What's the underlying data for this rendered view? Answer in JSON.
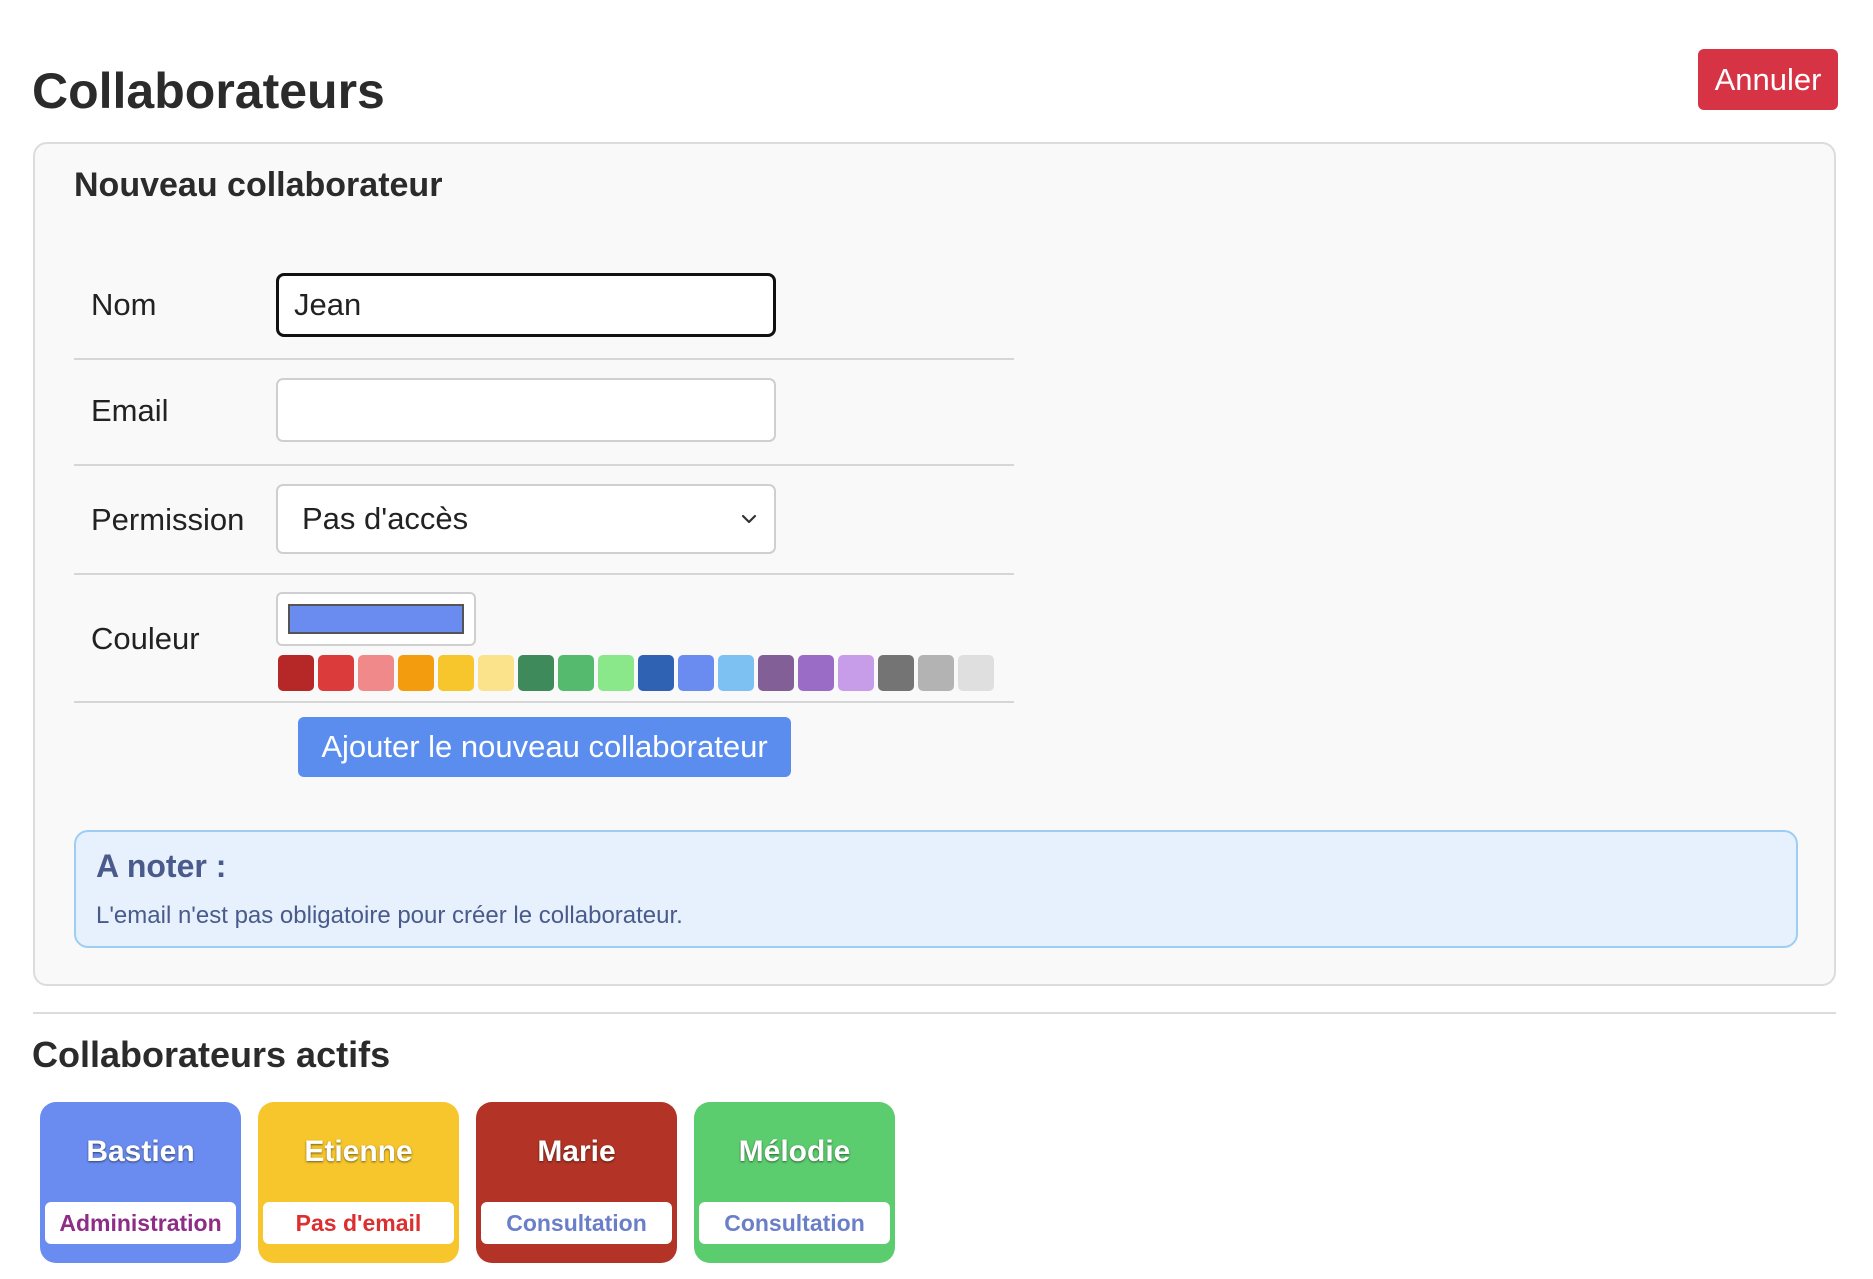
{
  "header": {
    "title": "Collaborateurs",
    "cancel_label": "Annuler"
  },
  "form": {
    "title": "Nouveau collaborateur",
    "name_label": "Nom",
    "name_value": "Jean",
    "email_label": "Email",
    "email_value": "",
    "permission_label": "Permission",
    "permission_value": "Pas d'accès",
    "color_label": "Couleur",
    "selected_color": "#6a8cf0",
    "palette": [
      "#b62727",
      "#dc3b3b",
      "#f08a8a",
      "#f39c0d",
      "#f6c62c",
      "#fae38a",
      "#3e8a5a",
      "#55ba6e",
      "#8ae88a",
      "#2f62b2",
      "#6a8cf0",
      "#7cc1f2",
      "#835f97",
      "#9b6cc5",
      "#c79de9",
      "#747474",
      "#b3b3b3",
      "#dfdfdf"
    ],
    "submit_label": "Ajouter le nouveau collaborateur"
  },
  "note": {
    "title": "A noter :",
    "text": "L'email n'est pas obligatoire pour créer le collaborateur."
  },
  "active": {
    "title": "Collaborateurs actifs",
    "collaborators": [
      {
        "name": "Bastien",
        "badge": "Administration",
        "color": "#6a8cf0",
        "badge_color": "#8e2c86"
      },
      {
        "name": "Etienne",
        "badge": "Pas d'email",
        "color": "#f6c62c",
        "badge_color": "#dc2f2f"
      },
      {
        "name": "Marie",
        "badge": "Consultation",
        "color": "#b33426",
        "badge_color": "#6a7fc8"
      },
      {
        "name": "Mélodie",
        "badge": "Consultation",
        "color": "#5ccd6e",
        "badge_color": "#6a7fc8"
      }
    ]
  }
}
